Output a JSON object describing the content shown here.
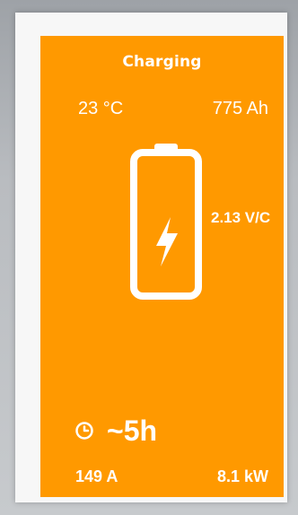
{
  "status": {
    "title": "Charging"
  },
  "readings": {
    "temperature": "23 °C",
    "capacity": "775 Ah",
    "voltage_per_cell": "2.13 V/C",
    "time_remaining": "~5h",
    "current": "149 A",
    "power": "8.1 kW"
  },
  "icons": {
    "battery": "battery-charging-icon",
    "clock": "clock-icon"
  },
  "colors": {
    "card_background": "#ff9900",
    "text": "#ffffff",
    "frame": "#f7f7f7",
    "background": "#b9bcc0"
  }
}
